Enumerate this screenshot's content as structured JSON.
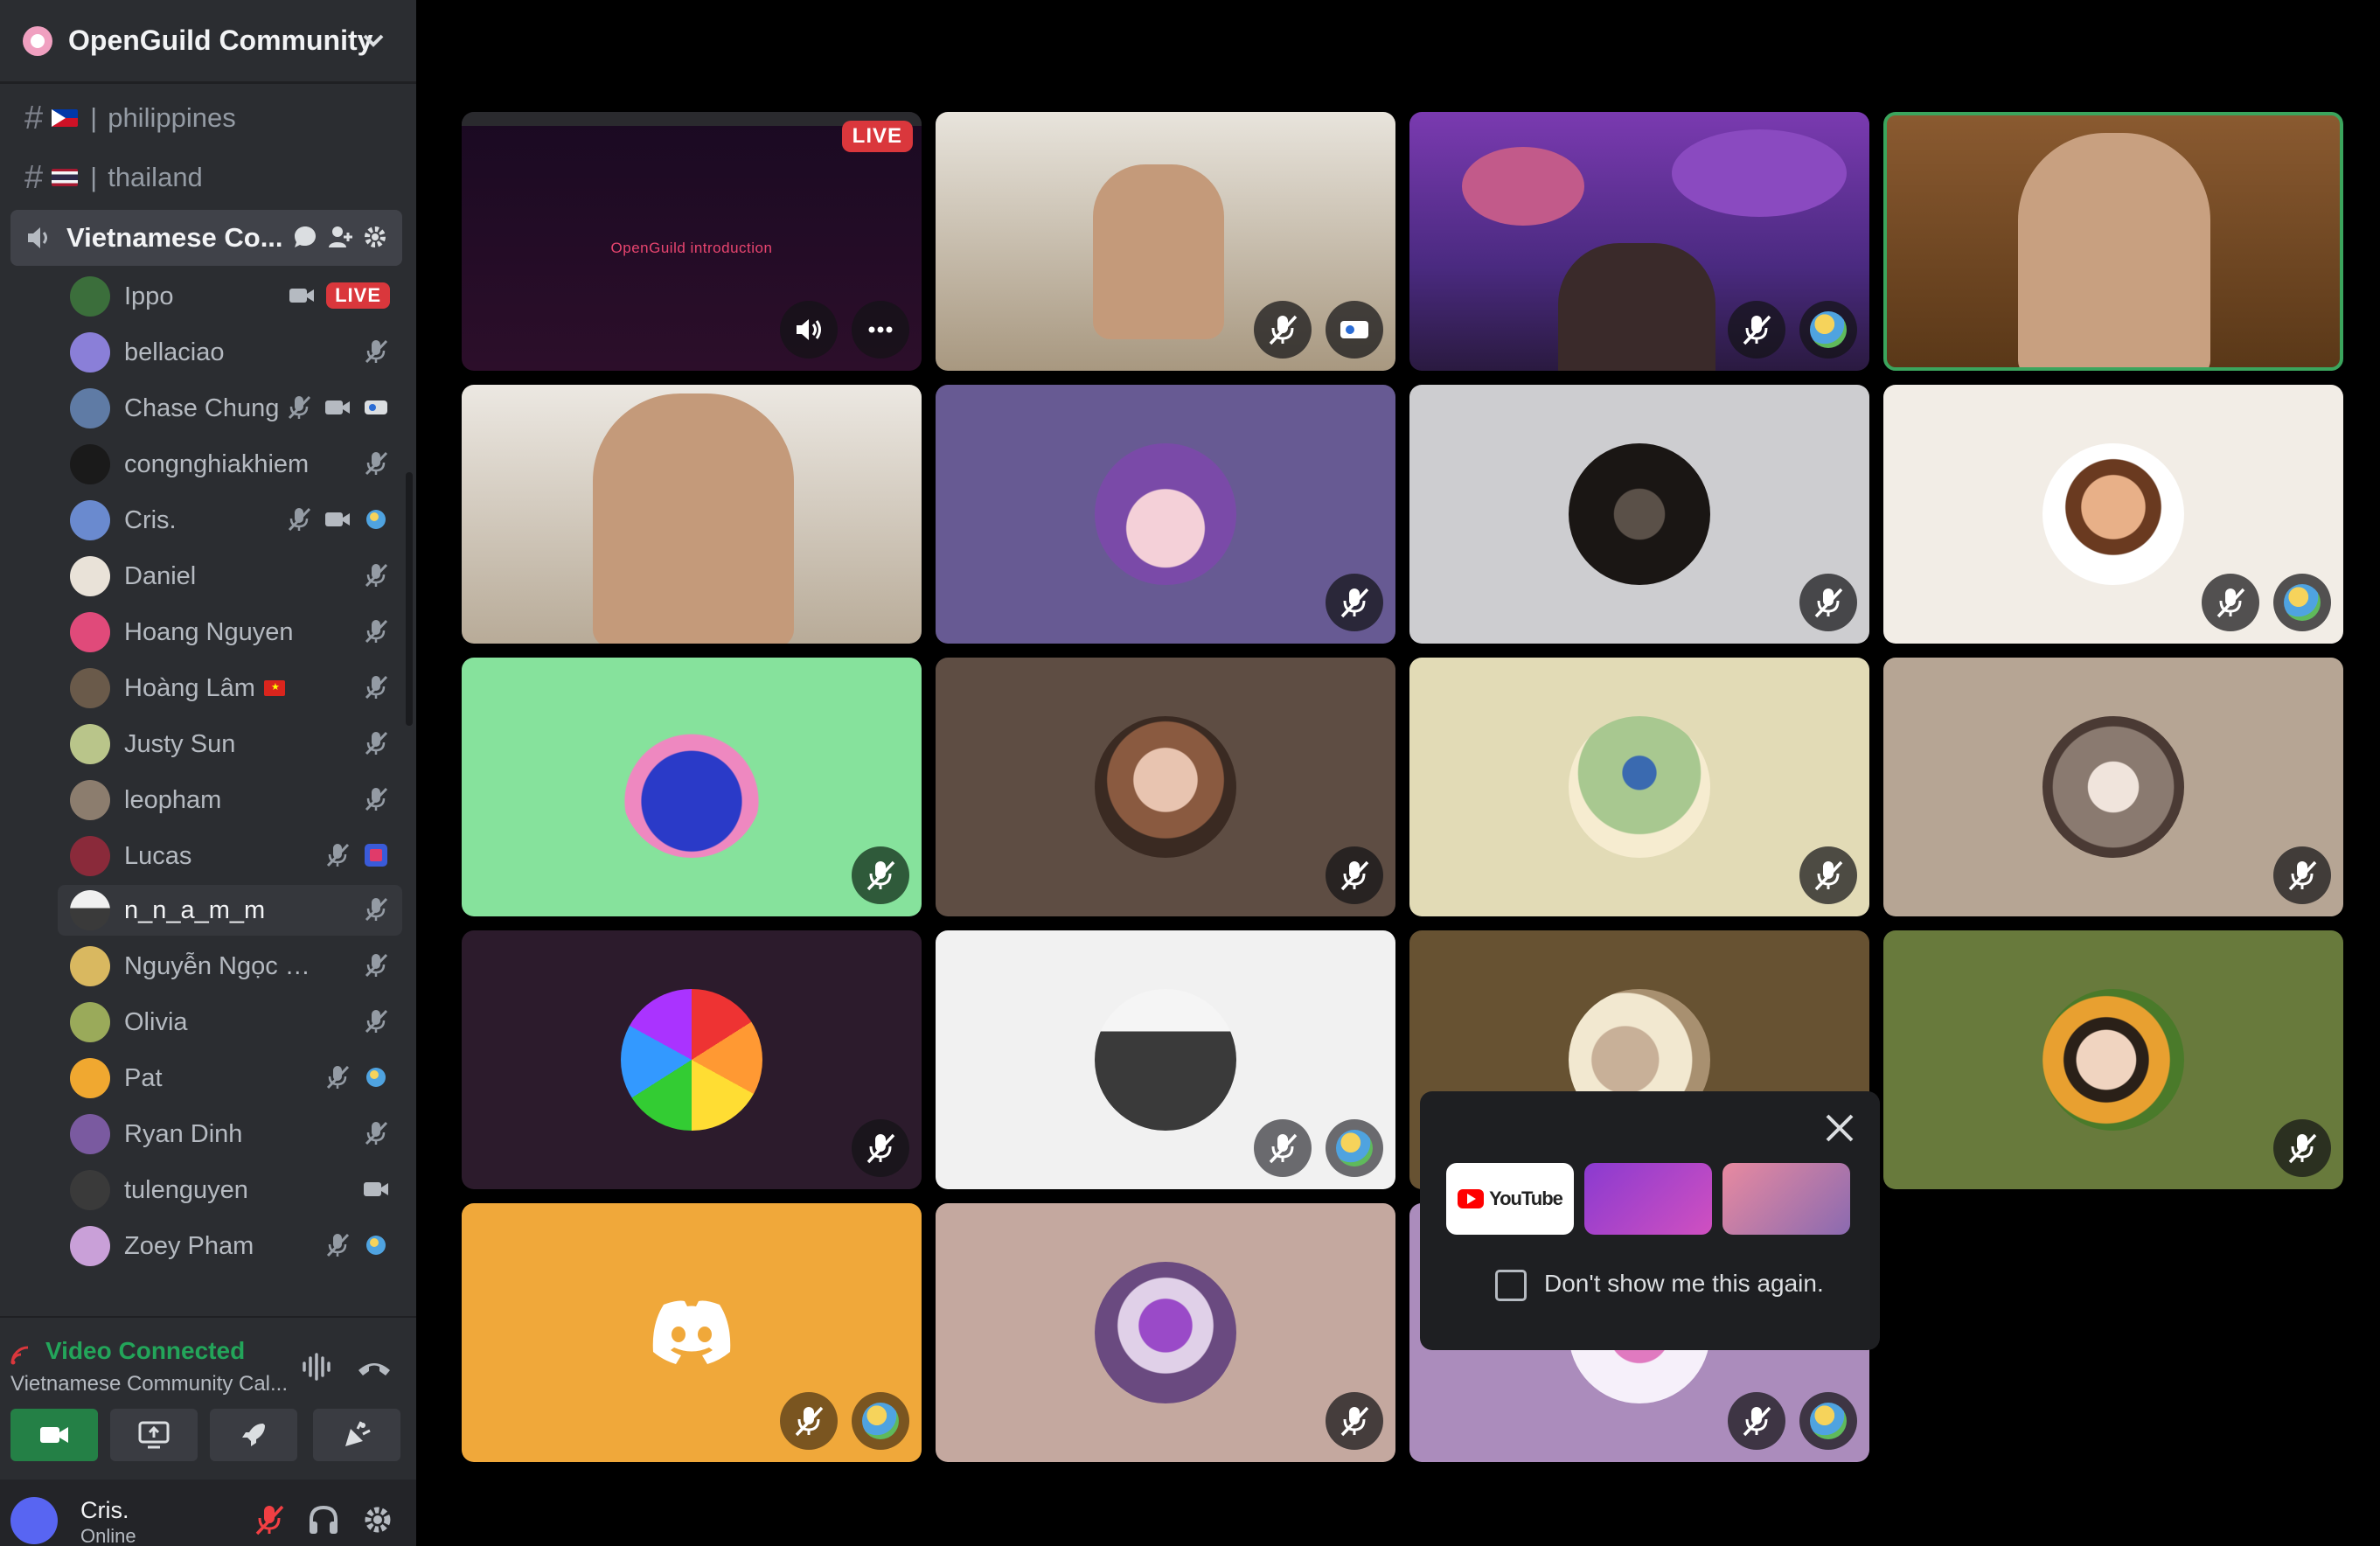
{
  "server": {
    "name": "OpenGuild Community"
  },
  "channels": [
    {
      "name": "philippines"
    },
    {
      "name": "thailand"
    }
  ],
  "voice_channel": {
    "name": "Vietnamese Co..."
  },
  "members": [
    {
      "name": "Ippo",
      "live": "LIVE"
    },
    {
      "name": "bellaciao"
    },
    {
      "name": "Chase Chung"
    },
    {
      "name": "congnghiakhiem"
    },
    {
      "name": "Cris."
    },
    {
      "name": "Daniel"
    },
    {
      "name": "Hoang Nguyen"
    },
    {
      "name": "Hoàng Lâm"
    },
    {
      "name": "Justy Sun"
    },
    {
      "name": "leopham"
    },
    {
      "name": "Lucas"
    },
    {
      "name": "n_n_a_m_m"
    },
    {
      "name": "Nguyễn Ngọc Phú S..."
    },
    {
      "name": "Olivia"
    },
    {
      "name": "Pat"
    },
    {
      "name": "Ryan Dinh"
    },
    {
      "name": "tulenguyen"
    },
    {
      "name": "Zoey Pham"
    }
  ],
  "voice_status": {
    "title": "Video Connected",
    "channel": "Vietnamese Community Cal..."
  },
  "user": {
    "name": "Cris.",
    "status": "Online"
  },
  "stream": {
    "live": "LIVE",
    "title": "OpenGuild introduction"
  },
  "promo": {
    "youtube": "YouTube",
    "checkbox_label": "Don't show me this again."
  },
  "colors": {
    "accent_green": "#23a55a",
    "live_red": "#da373c",
    "sidebar": "#2b2d31"
  }
}
